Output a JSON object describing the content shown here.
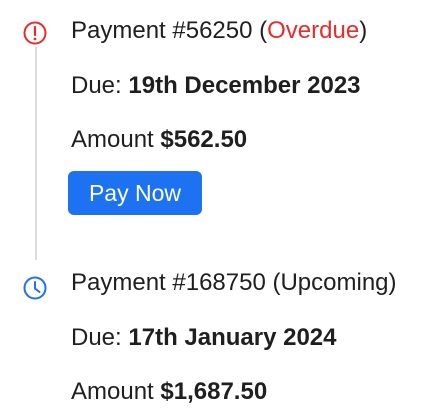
{
  "payments": [
    {
      "title_prefix": "Payment #56250 (",
      "status": "Overdue",
      "title_suffix": ")",
      "due_label": "Due: ",
      "due_date": "19th December 2023",
      "amount_label": "Amount ",
      "amount": "$562.50",
      "action_label": "Pay Now",
      "icon": "exclamation-circle-icon",
      "status_color": "#ea2b2b"
    },
    {
      "title": "Payment #168750 (Upcoming)",
      "due_label": "Due: ",
      "due_date": "17th January 2024",
      "amount_label": "Amount ",
      "amount": "$1,687.50",
      "icon": "clock-icon",
      "status_color": "#1d72f2"
    }
  ],
  "colors": {
    "accent": "#1d72f2",
    "overdue": "#ea2b2b",
    "timeline": "#dcdcdc",
    "text": "#1f1f1f"
  }
}
